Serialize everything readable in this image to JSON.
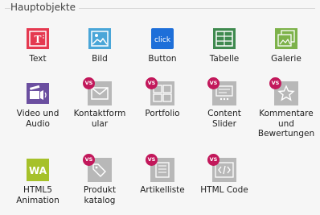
{
  "section": {
    "title": "Hauptobjekte"
  },
  "badge_text": "VS",
  "tiles": [
    {
      "label": "Text",
      "icon": "text-icon",
      "color": "#e53950"
    },
    {
      "label": "Bild",
      "icon": "image-icon",
      "color": "#4aa6d8"
    },
    {
      "label": "Button",
      "icon": "button-icon",
      "color": "#1e6fd9",
      "icon_text": "click"
    },
    {
      "label": "Tabelle",
      "icon": "table-icon",
      "color": "#3f8a4f"
    },
    {
      "label": "Galerie",
      "icon": "gallery-icon",
      "color": "#7db24a"
    },
    {
      "label": "Video und Audio",
      "icon": "video-audio-icon",
      "color": "#6b4fa0"
    },
    {
      "label": "Kontaktformular",
      "label_display": "Kontaktform ular",
      "icon": "contact-form-icon",
      "color": "#b8b8b8"
    },
    {
      "label": "Portfolio",
      "icon": "portfolio-icon",
      "color": "#b8b8b8"
    },
    {
      "label": "Content Slider",
      "icon": "content-slider-icon",
      "color": "#b8b8b8"
    },
    {
      "label": "Kommentare und Bewertungen",
      "icon": "comments-ratings-icon",
      "color": "#b8b8b8"
    },
    {
      "label": "HTML5 Animation",
      "icon": "html5-animation-icon",
      "color": "#a6c12a"
    },
    {
      "label": "Produkt katalog",
      "icon": "product-catalog-icon",
      "color": "#b8b8b8"
    },
    {
      "label": "Artikelliste",
      "icon": "article-list-icon",
      "color": "#b8b8b8"
    },
    {
      "label": "HTML Code",
      "icon": "html-code-icon",
      "color": "#b8b8b8"
    }
  ]
}
